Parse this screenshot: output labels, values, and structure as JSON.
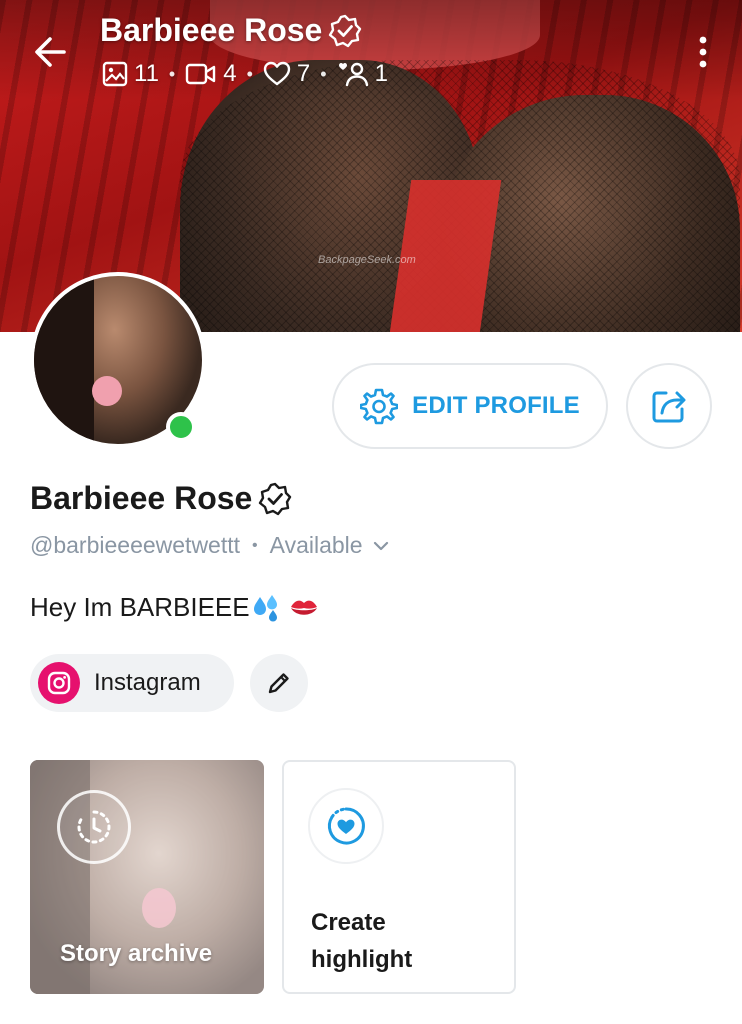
{
  "colors": {
    "accent": "#1e9ae0",
    "online": "#2ec24a",
    "instagram": "#e6116e",
    "muted": "#8a96a3"
  },
  "header": {
    "name": "Barbieee Rose",
    "stats": {
      "photos": "11",
      "videos": "4",
      "likes": "7",
      "fans": "1"
    },
    "watermark": "BackpageSeek.com"
  },
  "actions": {
    "edit_profile": "EDIT PROFILE"
  },
  "profile": {
    "name": "Barbieee Rose",
    "handle": "@barbieeeewetwettt",
    "separator": "•",
    "status": "Available",
    "bio": "Hey Im BARBIEEE"
  },
  "links": {
    "instagram_label": "Instagram"
  },
  "stories": {
    "archive_label": "Story archive",
    "create_label": "Create highlight"
  },
  "icons": {
    "back": "arrow-left-icon",
    "verified": "verified-badge-icon",
    "photos": "image-icon",
    "videos": "video-icon",
    "likes": "heart-icon",
    "fans": "fan-icon",
    "more": "more-vertical-icon",
    "edit": "gear-icon",
    "share": "share-icon",
    "instagram": "instagram-icon",
    "pencil": "pencil-icon",
    "archive": "clock-history-icon",
    "highlight": "heart-circle-icon"
  }
}
